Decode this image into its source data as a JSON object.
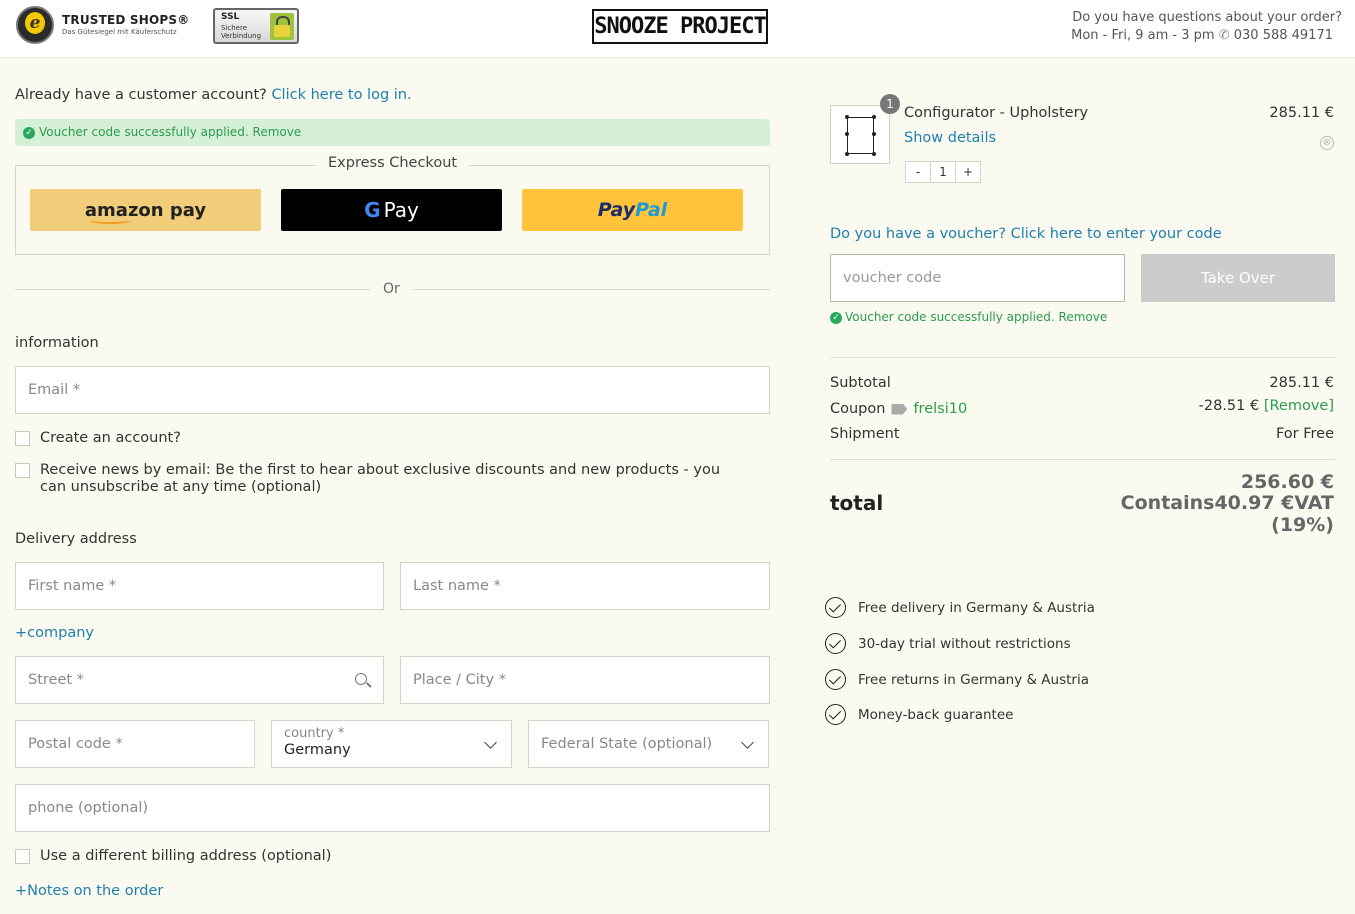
{
  "header": {
    "trusted_shops_title": "TRUSTED SHOPS®",
    "trusted_shops_sub": "Das Gütesiegel mit Käuferschutz",
    "ssl_title": "SSL",
    "ssl_sub": "Sichere Verbindung",
    "brand": "SNOOZE PROJECT",
    "help_question": "Do you have questions about your order?",
    "help_hours": "Mon - Fri, 9 am - 3 pm",
    "help_phone": "030 588 49171"
  },
  "account": {
    "question": "Already have a customer account?",
    "login_link": "Click here to log in."
  },
  "voucher_notice": "Voucher code successfully applied. Remove",
  "express": {
    "title": "Express Checkout",
    "amazon": "amazon pay",
    "gpay_g": "G",
    "gpay": "Pay",
    "paypal_1": "Pay",
    "paypal_2": "Pal",
    "or": "Or"
  },
  "information": {
    "heading": "information",
    "email_placeholder": "Email",
    "create_account": "Create an account?",
    "newsletter": "Receive news by email: Be the first to hear about exclusive discounts and new products - you can unsubscribe at any time (optional)"
  },
  "delivery": {
    "heading": "Delivery address",
    "first_name": "First name",
    "last_name": "Last name",
    "company_link": "+company",
    "street": "Street",
    "city": "Place / City",
    "postal": "Postal code",
    "country_label": "country",
    "country_value": "Germany",
    "state": "Federal State (optional)",
    "phone": "phone (optional)",
    "billing": "Use a different billing address (optional)",
    "notes_link": "+Notes on the order",
    "required_mark": "*"
  },
  "cart": {
    "quantity_badge": "1",
    "product_name": "Configurator - Upholstery",
    "show_details": "Show details",
    "price": "285.11 €",
    "remove_icon": "⊗",
    "stepper_minus": "-",
    "stepper_value": "1",
    "stepper_plus": "+"
  },
  "voucher": {
    "link": "Do you have a voucher? Click here to enter your code",
    "placeholder": "voucher code",
    "button": "Take Over",
    "success": "Voucher code successfully applied. Remove"
  },
  "summary": {
    "subtotal_label": "Subtotal",
    "subtotal_value": "285.11 €",
    "coupon_label": "Coupon",
    "coupon_code": "frelsi10",
    "coupon_value": "-28.51 €",
    "coupon_remove": "[Remove]",
    "shipment_label": "Shipment",
    "shipment_value": "For Free",
    "total_label": "total",
    "total_value": "256.60 €",
    "vat_line1": "Contains40.97 €VAT",
    "vat_line2": "(19%)"
  },
  "benefits": [
    "Free delivery in Germany & Austria",
    "30-day trial without restrictions",
    "Free returns in Germany & Austria",
    "Money-back guarantee"
  ],
  "colors": {
    "link": "#1f7fae",
    "success": "#2a9c4c",
    "amazon_button": "#f1cd7a",
    "paypal_button": "#ffc43a",
    "gpay_button": "#000000",
    "take_over_button": "#cccccc"
  }
}
